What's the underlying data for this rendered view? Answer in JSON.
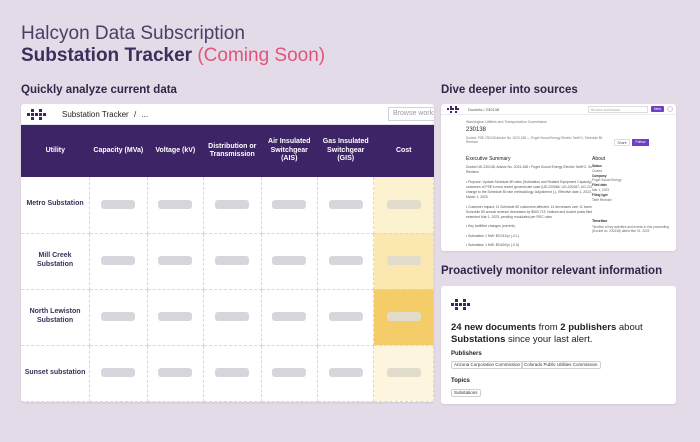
{
  "hero": {
    "subtitle": "Halcyon Data Subscription",
    "title": "Substation Tracker",
    "badge": "(Coming Soon)"
  },
  "sections": {
    "analyze": "Quickly analyze current data",
    "sources": "Dive deeper into sources",
    "monitor": "Proactively monitor relevant information"
  },
  "tracker": {
    "app_title": "Substation Tracker",
    "separator": "/",
    "ellipsis": "...",
    "search_placeholder": "Browse works",
    "columns": [
      "Utility",
      "Capacity (MVa)",
      "Voltage (kV)",
      "Distribution or Transmission",
      "Air Insulated Switchgear (AIS)",
      "Gas Insulated Switchgear (GIS)",
      "Cost"
    ],
    "rows": [
      "Metro Substation",
      "Mill Creek Substation",
      "North Lewiston Substation",
      "Sunset substation"
    ],
    "cost_colors": [
      "#fcf2cf",
      "#fbe8b0",
      "#f5cd68",
      "#fdf5de"
    ],
    "header_color": "#3d2466"
  },
  "sources": {
    "crumb": "Dockets / 230138",
    "search_placeholder": "Browse workspace",
    "new_label": "New",
    "sub_crumb": "Washington Utilities and Transportation Commission",
    "docket_id": "230138",
    "description": "Docket: PSE 230138 Advice No. 2023-158 — Puget Sound Energy Electric Tariff G, Schedule 80 Revision",
    "share_label": "Share",
    "follow_label": "Follow",
    "exec_heading": "Executive Summary",
    "exec_body": [
      "Docket UE-230138, Advice No. 2023-158 • Puget Sound Energy Electric Tariff G, Schedule 80 Revision",
      "• Purpose: Update Schedule 80 rates (Substation and Related Equipment Capacity) to reflect outcomes of PSE's most recent general rate case (UE-220066, UG-220067; UG-210918). No change to the Schedule 80 rate methodology. Adjustment (-), Effective date 1, 2023, issued March 1, 2023",
      "• Customer Impact: 11 Schedule 80 customers affected. 13 decreases over 11 increases. Overall Schedule 80 annual revenue decreases by $500,713. Notices and docket posts filed 2023 and extended Mar 1, 2023, pending modulated per RSC rules",
      "• Key tariff/fee changes (current):",
      "• Substation 1 MW: $9,031/yr (-0.1)",
      "• Substation 1 MW: $9,600/yr (-0.0)"
    ],
    "about_heading": "About",
    "meta": [
      {
        "label": "Status",
        "value": "Closed"
      },
      {
        "label": "Company",
        "value": "Puget Sound Energy"
      },
      {
        "label": "Filed date",
        "value": "Mar 1, 2023"
      },
      {
        "label": "Filing type",
        "value": "Tariff Revision"
      }
    ],
    "timeline_heading": "Timeline",
    "timeline_text": "Timeline of key activities and events in this proceeding (Docket no. 230138) dated Mar 01, 2023"
  },
  "monitor": {
    "count": "24 new documents",
    "mid": "from",
    "publishers_count": "2 publishers",
    "about": "about",
    "topic": "Substations",
    "since": "since your last alert.",
    "publishers_label": "Publishers",
    "publishers": [
      "Arizona Corporation Commission",
      "Colorado Public Utilities Commission"
    ],
    "topics_label": "Topics",
    "topics": [
      "Substations"
    ]
  },
  "icons": {
    "logo": "halcyon-logo-icon",
    "close": "close-icon"
  }
}
